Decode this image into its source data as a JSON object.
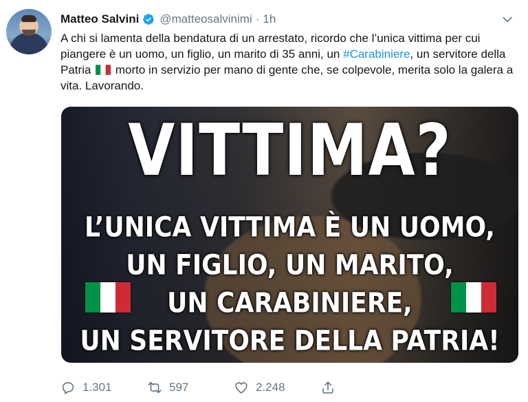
{
  "tweet": {
    "author_name": "Matteo Salvini",
    "handle": "@matteosalvinimi",
    "separator": "·",
    "time": "1h",
    "text_part1": "A chi si lamenta della bendatura di un arrestato, ricordo che l’unica vittima per cui piangere è un uomo, un figlio, un marito di 35 anni, un ",
    "hashtag": "#Carabiniere",
    "text_part2": ",",
    "text_part3": "un servitore della Patria",
    "text_part4": " morto in servizio per mano di gente che, se colpevole, merita solo la galera a vita. Lavorando."
  },
  "media": {
    "headline": "VITTIMA?",
    "lines": [
      "L’UNICA VITTIMA È UN UOMO,",
      "UN FIGLIO, UN MARITO,",
      "UN CARABINIERE,",
      "UN SERVITORE DELLA PATRIA!"
    ]
  },
  "actions": {
    "replies": "1.301",
    "retweets": "597",
    "likes": "2.248"
  },
  "colors": {
    "accent": "#1b95e0",
    "muted": "#657786",
    "flag_green": "#009246",
    "flag_white": "#ffffff",
    "flag_red": "#ce2b37"
  },
  "icons": [
    "verified-badge-icon",
    "chevron-down-icon",
    "reply-icon",
    "retweet-icon",
    "like-icon",
    "share-icon",
    "italy-flag-icon"
  ]
}
